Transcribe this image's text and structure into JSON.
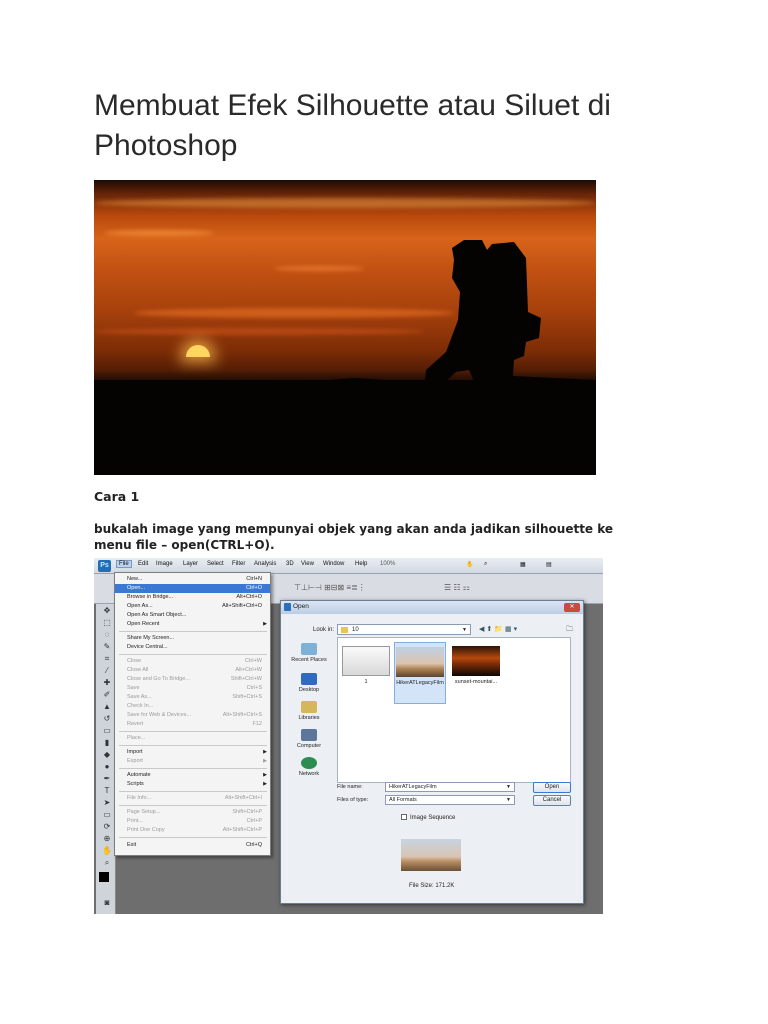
{
  "title": "Membuat Efek Silhouette atau Siluet di Photoshop",
  "section_heading": "Cara 1",
  "instruction": "bukalah image yang mempunyai objek yang akan anda jadikan silhouette ke menu file – open(CTRL+O).",
  "photoshop": {
    "logo": "Ps",
    "menu": [
      "File",
      "Edit",
      "Image",
      "Layer",
      "Select",
      "Filter",
      "Analysis",
      "3D",
      "View",
      "Window",
      "Help"
    ],
    "zoom": "100%",
    "file_menu": [
      {
        "label": "New...",
        "shortcut": "Ctrl+N",
        "state": "normal"
      },
      {
        "label": "Open...",
        "shortcut": "Ctrl+O",
        "state": "highlight"
      },
      {
        "label": "Browse in Bridge...",
        "shortcut": "Alt+Ctrl+O",
        "state": "normal"
      },
      {
        "label": "Open As...",
        "shortcut": "Alt+Shift+Ctrl+O",
        "state": "normal"
      },
      {
        "label": "Open As Smart Object...",
        "shortcut": "",
        "state": "normal"
      },
      {
        "label": "Open Recent",
        "shortcut": "",
        "state": "submenu"
      },
      {
        "label": "Share My Screen...",
        "shortcut": "",
        "state": "normal"
      },
      {
        "label": "Device Central...",
        "shortcut": "",
        "state": "normal"
      },
      {
        "label": "Close",
        "shortcut": "Ctrl+W",
        "state": "disabled"
      },
      {
        "label": "Close All",
        "shortcut": "Alt+Ctrl+W",
        "state": "disabled"
      },
      {
        "label": "Close and Go To Bridge...",
        "shortcut": "Shift+Ctrl+W",
        "state": "disabled"
      },
      {
        "label": "Save",
        "shortcut": "Ctrl+S",
        "state": "disabled"
      },
      {
        "label": "Save As...",
        "shortcut": "Shift+Ctrl+S",
        "state": "disabled"
      },
      {
        "label": "Check In...",
        "shortcut": "",
        "state": "disabled"
      },
      {
        "label": "Save for Web & Devices...",
        "shortcut": "Alt+Shift+Ctrl+S",
        "state": "disabled"
      },
      {
        "label": "Revert",
        "shortcut": "F12",
        "state": "disabled"
      },
      {
        "label": "Place...",
        "shortcut": "",
        "state": "disabled"
      },
      {
        "label": "Import",
        "shortcut": "",
        "state": "submenu"
      },
      {
        "label": "Export",
        "shortcut": "",
        "state": "submenu-disabled"
      },
      {
        "label": "Automate",
        "shortcut": "",
        "state": "submenu"
      },
      {
        "label": "Scripts",
        "shortcut": "",
        "state": "submenu"
      },
      {
        "label": "File Info...",
        "shortcut": "Alt+Shift+Ctrl+I",
        "state": "disabled"
      },
      {
        "label": "Page Setup...",
        "shortcut": "Shift+Ctrl+P",
        "state": "disabled"
      },
      {
        "label": "Print...",
        "shortcut": "Ctrl+P",
        "state": "disabled"
      },
      {
        "label": "Print One Copy",
        "shortcut": "Alt+Shift+Ctrl+P",
        "state": "disabled"
      },
      {
        "label": "Exit",
        "shortcut": "Ctrl+Q",
        "state": "normal"
      }
    ],
    "dialog": {
      "title": "Open",
      "look_in_label": "Look in:",
      "look_in_value": "10",
      "places": [
        "Recent Places",
        "Desktop",
        "Libraries",
        "Computer",
        "Network"
      ],
      "files": [
        {
          "name": "1",
          "selected": false
        },
        {
          "name": "HikerATLegacyFilm",
          "selected": true
        },
        {
          "name": "sunset-mountai...",
          "selected": false
        }
      ],
      "file_name_label": "File name:",
      "file_name_value": "HikerATLegacyFilm",
      "files_of_type_label": "Files of type:",
      "files_of_type_value": "All Formats",
      "open_button": "Open",
      "cancel_button": "Cancel",
      "image_sequence_label": "Image Sequence",
      "file_size": "File Size: 171.2K"
    }
  }
}
